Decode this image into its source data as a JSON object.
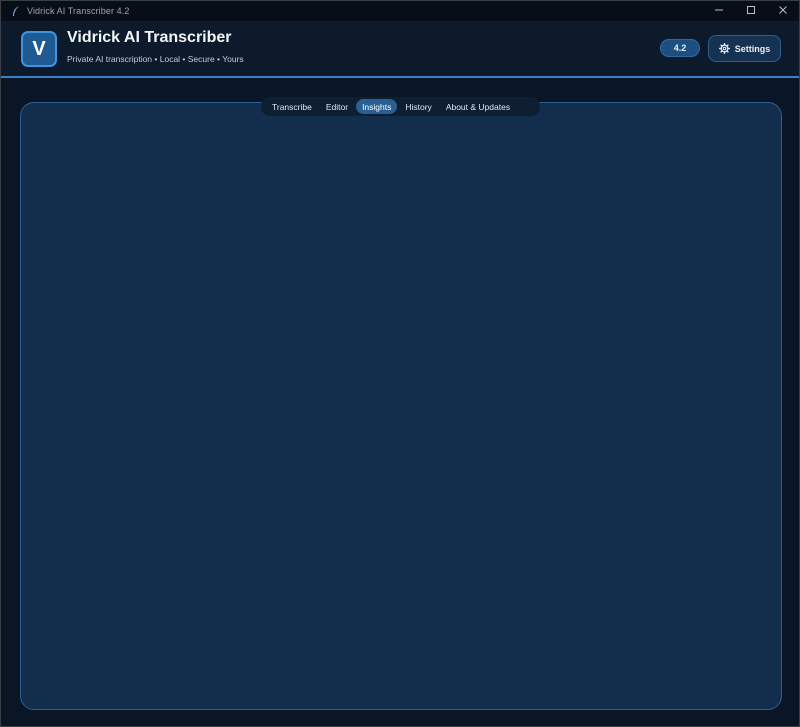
{
  "window": {
    "title": "Vidrick AI Transcriber 4.2"
  },
  "header": {
    "logo_letter": "V",
    "app_name": "Vidrick AI Transcriber",
    "tagline": "Private AI transcription • Local • Secure • Yours",
    "version_badge": "4.2",
    "settings_label": "Settings"
  },
  "tabs": [
    {
      "label": "Transcribe",
      "active": false
    },
    {
      "label": "Editor",
      "active": false
    },
    {
      "label": "Insights",
      "active": true
    },
    {
      "label": "History",
      "active": false
    },
    {
      "label": "About & Updates",
      "active": false
    }
  ],
  "icons": {
    "app": "feather-icon",
    "settings": "gear-icon",
    "minimize": "minimize-icon",
    "maximize": "maximize-icon",
    "close": "close-icon"
  },
  "colors": {
    "accent": "#3b7fc9",
    "header_bg": "#0c1a2c",
    "panel_bg": "#132d4c",
    "active_tab": "#2a5f94"
  }
}
